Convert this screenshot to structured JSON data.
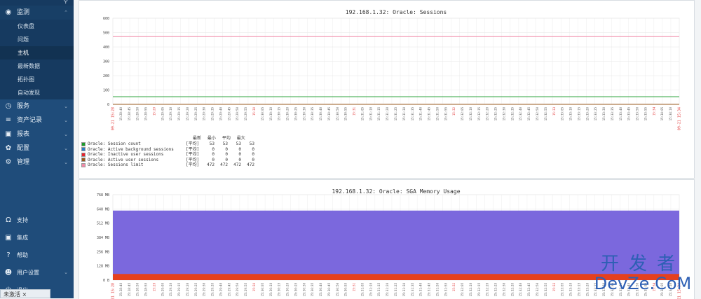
{
  "sidebar": {
    "search_icon": "search-icon",
    "items": [
      {
        "label": "监测",
        "icon": "eye-icon",
        "expanded": true,
        "children": [
          "仪表盘",
          "问题",
          "主机",
          "最新数据",
          "拓扑图",
          "自动发现"
        ],
        "selected": "主机"
      },
      {
        "label": "服务",
        "icon": "clock-icon"
      },
      {
        "label": "资产记录",
        "icon": "list-icon"
      },
      {
        "label": "报表",
        "icon": "bar-chart-icon"
      },
      {
        "label": "配置",
        "icon": "wrench-icon"
      },
      {
        "label": "管理",
        "icon": "gear-icon"
      }
    ],
    "bottom_items": [
      {
        "label": "支持",
        "icon": "headset-icon"
      },
      {
        "label": "集成",
        "icon": "zabbix-icon"
      },
      {
        "label": "帮助",
        "icon": "help-icon"
      },
      {
        "label": "用户设置",
        "icon": "user-icon"
      },
      {
        "label": "退出",
        "icon": "power-icon"
      }
    ],
    "activate_chip": "未激活 ×"
  },
  "graphs": [
    {
      "chart_data": {
        "type": "line",
        "title": "192.168.1.32: Oracle: Sessions",
        "ylim": [
          0,
          600
        ],
        "y_ticks": [
          "600",
          "500",
          "400",
          "300",
          "200",
          "100",
          "0"
        ],
        "x_start_label": "09-21 15:28",
        "x_end_label": "09-21 15:34",
        "x_major_labels": [
          "15:30",
          "15:31",
          "15:32",
          "15:33",
          "15:34"
        ],
        "x_minor_labels": [
          "15:28:40",
          "15:28:45",
          "15:28:50",
          "15:28:55",
          "15:29:00",
          "15:29:05",
          "15:29:10",
          "15:29:15",
          "15:29:20",
          "15:29:25",
          "15:29:30",
          "15:29:35",
          "15:29:40",
          "15:29:45",
          "15:29:50",
          "15:29:55",
          "15:30:00",
          "15:30:05",
          "15:30:10",
          "15:30:15",
          "15:30:20",
          "15:30:25",
          "15:30:30",
          "15:30:35",
          "15:30:40",
          "15:30:45",
          "15:30:50",
          "15:30:55",
          "15:31:00",
          "15:31:05",
          "15:31:10",
          "15:31:15",
          "15:31:20",
          "15:31:25",
          "15:31:30",
          "15:31:35",
          "15:31:40",
          "15:31:45",
          "15:31:50",
          "15:31:55",
          "15:32:00",
          "15:32:05",
          "15:32:10",
          "15:32:15",
          "15:32:20",
          "15:32:25",
          "15:32:30",
          "15:32:35",
          "15:32:40",
          "15:32:45",
          "15:32:50",
          "15:32:55",
          "15:33:00",
          "15:33:05",
          "15:33:10",
          "15:33:15",
          "15:33:20",
          "15:33:25",
          "15:33:30",
          "15:33:35",
          "15:33:40",
          "15:33:45",
          "15:33:50",
          "15:33:55",
          "15:34:00",
          "15:34:05",
          "15:34:10"
        ],
        "series": [
          {
            "name": "Oracle: Session count",
            "color": "#1a9c2a",
            "value": 53
          },
          {
            "name": "Oracle: Active background sessions",
            "color": "#2b7cc4",
            "value": 0
          },
          {
            "name": "Oracle: Inactive user sessions",
            "color": "#e5242d",
            "value": 0
          },
          {
            "name": "Oracle: Active user sessions",
            "color": "#9a5a1e",
            "value": 0
          },
          {
            "name": "Oracle: Sessions limit",
            "color": "#f08aa8",
            "value": 472
          }
        ]
      },
      "legend": {
        "headers": [
          "最新",
          "最小",
          "平均",
          "最大"
        ],
        "func": "[平均]",
        "rows": [
          {
            "values": [
              "53",
              "53",
              "53",
              "53"
            ]
          },
          {
            "values": [
              "0",
              "0",
              "0",
              "0"
            ]
          },
          {
            "values": [
              "0",
              "0",
              "0",
              "0"
            ]
          },
          {
            "values": [
              "0",
              "0",
              "0",
              "0"
            ]
          },
          {
            "values": [
              "472",
              "472",
              "472",
              "472"
            ]
          }
        ]
      }
    },
    {
      "chart_data": {
        "type": "area",
        "title": "192.168.1.32: Oracle: SGA Memory Usage",
        "ylim": [
          0,
          768
        ],
        "y_ticks": [
          "768 MB",
          "640 MB",
          "512 MB",
          "384 MB",
          "256 MB",
          "128 MB",
          "0 B"
        ],
        "series": [
          {
            "color": "#7b68dd",
            "value": 625
          },
          {
            "color": "#e5401e",
            "value": 55
          }
        ]
      }
    }
  ],
  "watermark": {
    "cn": "开发者",
    "en": "DevZe.CoM"
  }
}
